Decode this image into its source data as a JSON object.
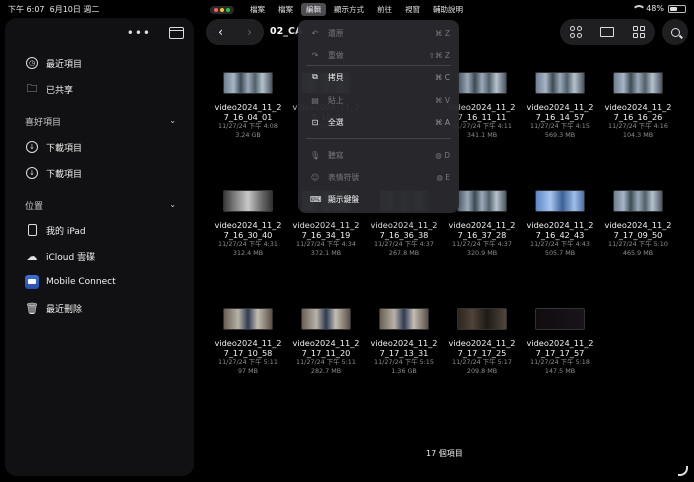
{
  "status": {
    "time": "下午 6:07",
    "date": "6月10日 週二",
    "battery": "48%"
  },
  "menubar": {
    "items": [
      "檔案",
      "檔案",
      "編輯",
      "顯示方式",
      "前往",
      "視窗",
      "輔助說明"
    ],
    "active_index": 2
  },
  "sidebar": {
    "recent": "最近項目",
    "shared": "已共享",
    "favorites_header": "喜好項目",
    "favorites": [
      "下載項目",
      "下載項目"
    ],
    "locations_header": "位置",
    "locations": [
      "我的 iPad",
      "iCloud 雲碟",
      "Mobile Connect",
      "最近刪除"
    ]
  },
  "toolbar": {
    "folder_title": "02_CA"
  },
  "edit_menu": {
    "items": [
      {
        "label": "還原",
        "shortcut": "⌘ Z",
        "icon": "undo-icon",
        "enabled": false
      },
      {
        "label": "重做",
        "shortcut": "⇧⌘ Z",
        "icon": "redo-icon",
        "enabled": false
      },
      {
        "label": "拷貝",
        "shortcut": "⌘ C",
        "icon": "copy-icon",
        "enabled": true
      },
      {
        "label": "貼上",
        "shortcut": "⌘ V",
        "icon": "paste-icon",
        "enabled": false
      },
      {
        "label": "全選",
        "shortcut": "⌘ A",
        "icon": "select-all-icon",
        "enabled": true
      },
      {
        "label": "聽寫",
        "shortcut": "D",
        "icon": "microphone-icon",
        "enabled": false
      },
      {
        "label": "表情符號",
        "shortcut": "E",
        "icon": "emoji-icon",
        "enabled": false
      },
      {
        "label": "顯示鍵盤",
        "shortcut": "",
        "icon": "keyboard-icon",
        "enabled": true
      }
    ]
  },
  "files": [
    {
      "l1": "video2024_11_2",
      "l2": "7_16_04_01",
      "date": "11/27/24 下午 4:08",
      "size": "3.24 GB",
      "thumb": "street"
    },
    {
      "l1": "video2024_11_2",
      "l2": "7_16_0",
      "date": "11/27/",
      "size": "",
      "thumb": "street"
    },
    {
      "l1": "",
      "l2": "",
      "date": "",
      "size": "",
      "thumb": "none"
    },
    {
      "l1": "video2024_11_2",
      "l2": "7_16_11_11",
      "date": "11/27/24 下午 4:11",
      "size": "341.1 MB",
      "thumb": "street"
    },
    {
      "l1": "video2024_11_2",
      "l2": "7_16_14_57",
      "date": "11/27/24 下午 4:15",
      "size": "569.3 MB",
      "thumb": "street"
    },
    {
      "l1": "video2024_11_2",
      "l2": "7_16_16_26",
      "date": "11/27/24 下午 4:16",
      "size": "104.3 MB",
      "thumb": "street"
    },
    {
      "l1": "video2024_11_2",
      "l2": "7_16_30_40",
      "date": "11/27/24 下午 4:31",
      "size": "312.4 MB",
      "thumb": "car"
    },
    {
      "l1": "video2024_11_2",
      "l2": "7_16_34_19",
      "date": "11/27/24 下午 4:34",
      "size": "372.1 MB",
      "thumb": "street"
    },
    {
      "l1": "video2024_11_2",
      "l2": "7_16_36_38",
      "date": "11/27/24 下午 4:37",
      "size": "267.8 MB",
      "thumb": "street"
    },
    {
      "l1": "video2024_11_2",
      "l2": "7_16_37_28",
      "date": "11/27/24 下午 4:37",
      "size": "320.9 MB",
      "thumb": "street"
    },
    {
      "l1": "video2024_11_2",
      "l2": "7_16_42_43",
      "date": "11/27/24 下午 4:43",
      "size": "505.7 MB",
      "thumb": "blue"
    },
    {
      "l1": "video2024_11_2",
      "l2": "7_17_09_50",
      "date": "11/27/24 下午 5:10",
      "size": "465.9 MB",
      "thumb": "street"
    },
    {
      "l1": "video2024_11_2",
      "l2": "7_17_10_58",
      "date": "11/27/24 下午 5:11",
      "size": "97 MB",
      "thumb": "office"
    },
    {
      "l1": "video2024_11_2",
      "l2": "7_17_11_20",
      "date": "11/27/24 下午 5:11",
      "size": "282.7 MB",
      "thumb": "office"
    },
    {
      "l1": "video2024_11_2",
      "l2": "7_17_13_31",
      "date": "11/27/24 下午 5:15",
      "size": "1.36 GB",
      "thumb": "office"
    },
    {
      "l1": "video2024_11_2",
      "l2": "7_17_17_25",
      "date": "11/27/24 下午 5:17",
      "size": "209.8 MB",
      "thumb": "dark"
    },
    {
      "l1": "video2024_11_2",
      "l2": "7_17_17_57",
      "date": "11/27/24 下午 5:18",
      "size": "147.5 MB",
      "thumb": "black"
    }
  ],
  "footer": {
    "count": "17 個項目"
  },
  "colors": {
    "sidebar_bg": "#111113",
    "menu_bg": "#2a2a2e",
    "secondary_text": "#8e8e93"
  }
}
